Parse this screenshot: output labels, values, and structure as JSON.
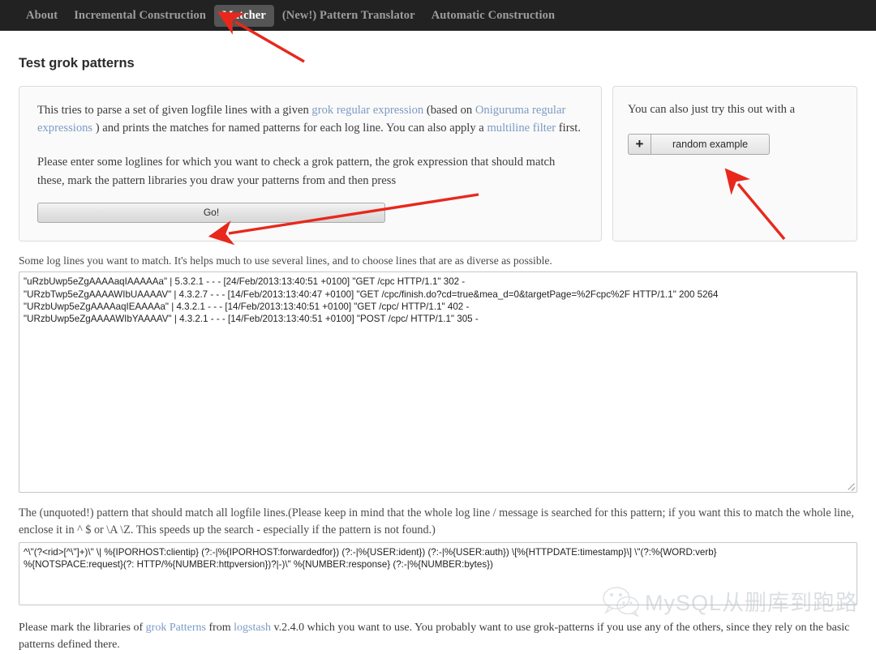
{
  "nav": {
    "items": [
      {
        "label": "About",
        "active": false
      },
      {
        "label": "Incremental Construction",
        "active": false
      },
      {
        "label": "Matcher",
        "active": true
      },
      {
        "label": "(New!) Pattern Translator",
        "active": false
      },
      {
        "label": "Automatic Construction",
        "active": false
      }
    ]
  },
  "page": {
    "title": "Test grok patterns"
  },
  "intro_panel": {
    "paragraph1": {
      "part1": "This tries to parse a set of given logfile lines with a given ",
      "link1": "grok regular expression",
      "part2": " (based on ",
      "link2": "Oniguruma regular expressions",
      "part3": " ) and prints the matches for named patterns for each log line. You can also apply a ",
      "link3": "multiline filter",
      "part4": " first."
    },
    "paragraph2": "Please enter some loglines for which you want to check a grok pattern, the grok expression that should match these, mark the pattern libraries you draw your patterns from and then press",
    "go_button": "Go!"
  },
  "example_panel": {
    "text": "You can also just try this out with a",
    "plus_icon": "plus-icon",
    "random_button": "random example"
  },
  "loglines_field": {
    "label": "Some log lines you want to match. It's helps much to use several lines, and to choose lines that are as diverse as possible.",
    "value": "\"uRzbUwp5eZgAAAAaqIAAAAAa\" | 5.3.2.1 - - - [24/Feb/2013:13:40:51 +0100] \"GET /cpc HTTP/1.1\" 302 -\n\"URzbTwp5eZgAAAAWIbUAAAAV\" | 4.3.2.7 - - - [14/Feb/2013:13:40:47 +0100] \"GET /cpc/finish.do?cd=true&mea_d=0&targetPage=%2Fcpc%2F HTTP/1.1\" 200 5264\n\"URzbUwp5eZgAAAAaqIEAAAAa\" | 4.3.2.1 - - - [14/Feb/2013:13:40:51 +0100] \"GET /cpc/ HTTP/1.1\" 402 -\n\"URzbUwp5eZgAAAAWIbYAAAAV\" | 4.3.2.1 - - - [14/Feb/2013:13:40:51 +0100] \"POST /cpc/ HTTP/1.1\" 305 -"
  },
  "pattern_field": {
    "label": "The (unquoted!) pattern that should match all logfile lines.(Please keep in mind that the whole log line / message is searched for this pattern; if you want this to match the whole line, enclose it in ^ $ or \\A \\Z. This speeds up the search - especially if the pattern is not found.)",
    "value": "^\\\"(?<rid>[^\\\"]+)\\\" \\| %{IPORHOST:clientip} (?:-|%{IPORHOST:forwardedfor}) (?:-|%{USER:ident}) (?:-|%{USER:auth}) \\[%{HTTPDATE:timestamp}\\] \\\"(?:%{WORD:verb}\n%{NOTSPACE:request}(?: HTTP/%{NUMBER:httpversion})?|-)\\\" %{NUMBER:response} (?:-|%{NUMBER:bytes})"
  },
  "libraries_footer": {
    "part1": "Please mark the libraries of ",
    "link1": "grok Patterns",
    "part2": " from ",
    "link2": "logstash",
    "part3": " v.2.4.0 which you want to use. You probably want to use grok-patterns if you use any of the others, since they rely on the basic patterns defined there."
  },
  "watermark": {
    "icon": "wechat-icon",
    "text": "MySQL从删库到跑路"
  },
  "annotations": {
    "arrow_color": "#e8281c",
    "arrows": [
      {
        "name": "arrow-to-matcher-tab",
        "target": "Matcher tab"
      },
      {
        "name": "arrow-to-go-button",
        "target": "Go! button"
      },
      {
        "name": "arrow-to-random-example-button",
        "target": "random example button"
      }
    ]
  },
  "colors": {
    "navbar_bg": "#222222",
    "nav_active_bg": "#555555",
    "link": "#7b9bc4",
    "panel_bg": "#fafafa",
    "panel_border": "#dcdcdc"
  }
}
